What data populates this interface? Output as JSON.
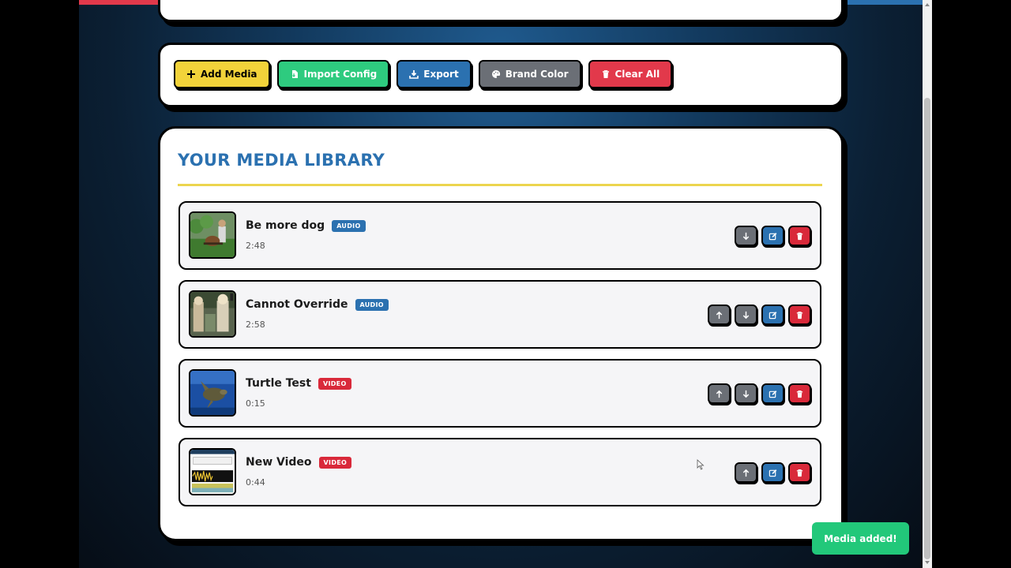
{
  "colors": {
    "stripe": [
      "#e2394b",
      "#f2c934",
      "#2b71b0"
    ],
    "accent_blue": "#2b71b0",
    "accent_yellow": "#f2d33a",
    "accent_green": "#22c87a",
    "accent_red": "#d9293a",
    "accent_gray": "#6b6f76"
  },
  "toolbar": {
    "buttons": [
      {
        "label": "Add Media",
        "icon": "plus-icon",
        "bg": "#f2d33a",
        "fg": "#000000"
      },
      {
        "label": "Import Config",
        "icon": "file-import-icon",
        "bg": "#2ecb7f",
        "fg": "#ffffff"
      },
      {
        "label": "Export",
        "icon": "download-icon",
        "bg": "#2b71b0",
        "fg": "#ffffff"
      },
      {
        "label": "Brand Color",
        "icon": "palette-icon",
        "bg": "#6b6f76",
        "fg": "#ffffff"
      },
      {
        "label": "Clear All",
        "icon": "trash-icon",
        "bg": "#e2394b",
        "fg": "#ffffff"
      }
    ]
  },
  "library": {
    "title": "YOUR MEDIA LIBRARY",
    "items": [
      {
        "title": "Be more dog",
        "type": "AUDIO",
        "duration": "2:48",
        "thumb": "thumbnail-man-guitar",
        "actions": [
          "move-down",
          "edit",
          "delete"
        ]
      },
      {
        "title": "Cannot Override",
        "type": "AUDIO",
        "duration": "2:58",
        "thumb": "thumbnail-street-scene",
        "actions": [
          "move-up",
          "move-down",
          "edit",
          "delete"
        ]
      },
      {
        "title": "Turtle Test",
        "type": "VIDEO",
        "duration": "0:15",
        "thumb": "thumbnail-sea-turtle",
        "actions": [
          "move-up",
          "move-down",
          "edit",
          "delete"
        ]
      },
      {
        "title": "New Video",
        "type": "VIDEO",
        "duration": "0:44",
        "thumb": "thumbnail-waveform-editor",
        "actions": [
          "move-up",
          "edit",
          "delete"
        ]
      }
    ]
  },
  "toast": {
    "message": "Media added!"
  }
}
